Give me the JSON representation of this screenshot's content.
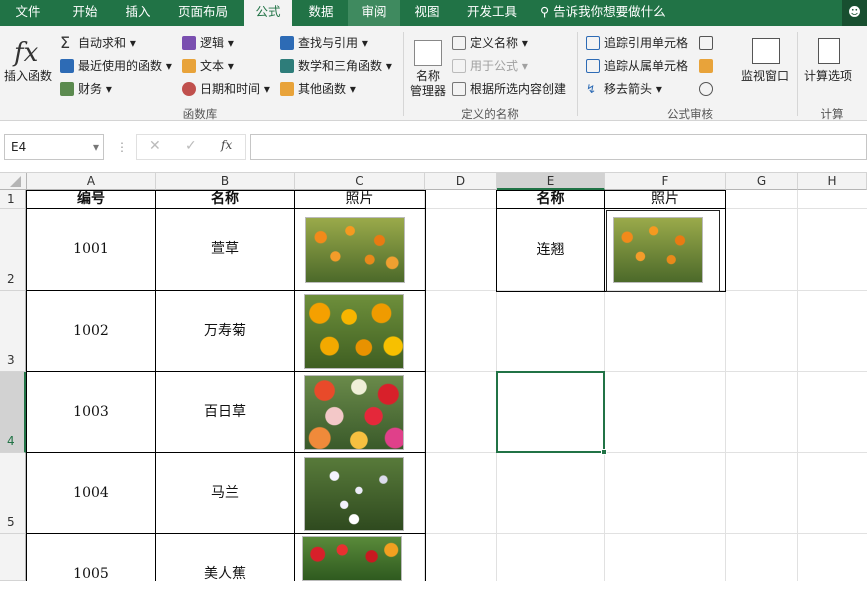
{
  "tabs": [
    {
      "label": "文件"
    },
    {
      "label": "开始"
    },
    {
      "label": "插入"
    },
    {
      "label": "页面布局"
    },
    {
      "label": "公式"
    },
    {
      "label": "数据"
    },
    {
      "label": "审阅"
    },
    {
      "label": "视图"
    },
    {
      "label": "开发工具"
    }
  ],
  "tell_me": "告诉我你想要做什么",
  "ribbon": {
    "insert_function": "插入函数",
    "autosum": "自动求和",
    "recent": "最近使用的函数",
    "financial": "财务",
    "logical": "逻辑",
    "text": "文本",
    "datetime": "日期和时间",
    "lookup": "查找与引用",
    "math": "数学和三角函数",
    "more": "其他函数",
    "group_library": "函数库",
    "name_manager_1": "名称",
    "name_manager_2": "管理器",
    "define_name": "定义名称",
    "use_in_formula": "用于公式",
    "create_from_sel": "根据所选内容创建",
    "group_names": "定义的名称",
    "trace_precedents": "追踪引用单元格",
    "trace_dependents": "追踪从属单元格",
    "remove_arrows": "移去箭头",
    "watch_window": "监视窗口",
    "group_audit": "公式审核",
    "calc_options": "计算选项",
    "group_calc": "计算"
  },
  "formula_bar": {
    "name_box": "E4",
    "fx": "fx",
    "formula": ""
  },
  "columns": [
    "A",
    "B",
    "C",
    "D",
    "E",
    "F",
    "G",
    "H"
  ],
  "rows": [
    "1",
    "2",
    "3",
    "4",
    "5"
  ],
  "table": {
    "header": {
      "a": "编号",
      "b": "名称",
      "c": "照片"
    },
    "rows": [
      {
        "id": "1001",
        "name": "萱草"
      },
      {
        "id": "1002",
        "name": "万寿菊"
      },
      {
        "id": "1003",
        "name": "百日草"
      },
      {
        "id": "1004",
        "name": "马兰"
      },
      {
        "id": "1005",
        "name": "美人蕉"
      }
    ]
  },
  "lookup": {
    "header_name": "名称",
    "header_photo": "照片",
    "value": "连翘"
  },
  "colors": {
    "accent": "#217346",
    "selection": "#217346"
  }
}
